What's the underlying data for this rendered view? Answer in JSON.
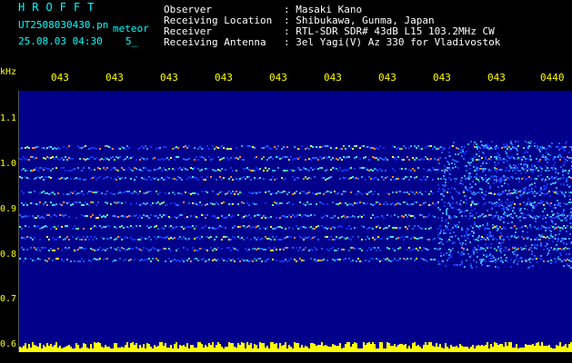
{
  "header": {
    "logo": "HROFFT",
    "filename": "UT2508030430.pn",
    "mode": "meteor",
    "datetime": "25.08.03 04:30",
    "frame": "5_",
    "info_labels": [
      "Observer",
      "Receiving Location",
      "Receiver",
      "Receiving Antenna"
    ],
    "info_values": [
      ": Masaki Kano",
      ": Shibukawa, Gunma, Japan",
      ": RTL-SDR SDR# 43dB L15 103.2MHz CW",
      ": 3el Yagi(V) Az 330 for Vladivostok"
    ]
  },
  "axis": {
    "unit": "kHz",
    "y_ticks": [
      "1.1",
      "1.0",
      "0.9",
      "0.8",
      "0.7",
      "0.6"
    ],
    "x_ticks": [
      "043",
      "043",
      "043",
      "043",
      "043",
      "043",
      "043",
      "043",
      "043",
      "0440"
    ]
  },
  "colors": {
    "background": "#000000",
    "spectrogram_bg": "#00008a",
    "axis_text": "#ffff00",
    "logo": "#00ffff",
    "info_text": "#ffffff",
    "signal_band": "#ffff00"
  }
}
